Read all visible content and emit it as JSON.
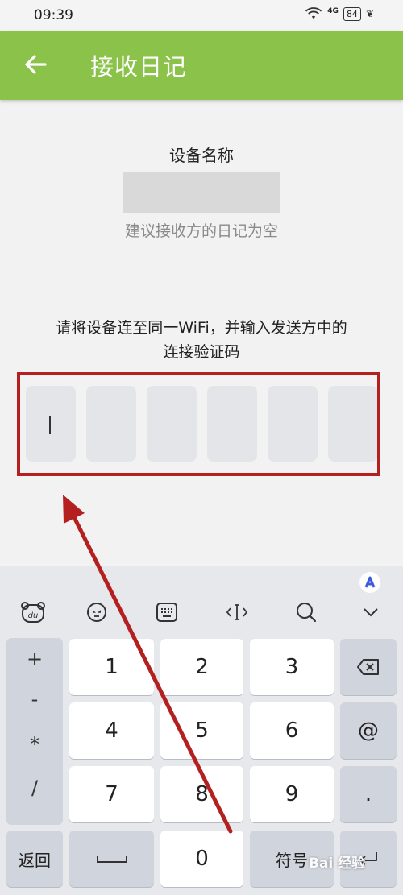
{
  "status_bar": {
    "time": "09:39",
    "network": "4G",
    "battery": "84"
  },
  "app_bar": {
    "title": "接收日记"
  },
  "content": {
    "device_label": "设备名称",
    "hint": "建议接收方的日记为空",
    "instruction_line1": "请将设备连至同一WiFi，并输入发送方中的",
    "instruction_line2": "连接验证码",
    "code_boxes": [
      "",
      "",
      "",
      "",
      "",
      ""
    ]
  },
  "keyboard": {
    "toolbar_icons": [
      "du-bear-icon",
      "emoji-icon",
      "keyboard-icon",
      "cursor-move-icon",
      "search-icon",
      "chevron-down-icon"
    ],
    "side_symbols": [
      "+",
      "-",
      "*",
      "/"
    ],
    "keys": {
      "k1": "1",
      "k2": "2",
      "k3": "3",
      "k4": "4",
      "k5": "5",
      "k6": "6",
      "k7": "7",
      "k8": "8",
      "k9": "9",
      "k0": "0",
      "at": "@",
      "dot": ".",
      "back": "返回",
      "symbols": "符号"
    }
  },
  "watermark": "Bai 经验",
  "colors": {
    "app_bar": "#8bc34a",
    "highlight": "#b3201f",
    "arrow": "#b3201f"
  }
}
